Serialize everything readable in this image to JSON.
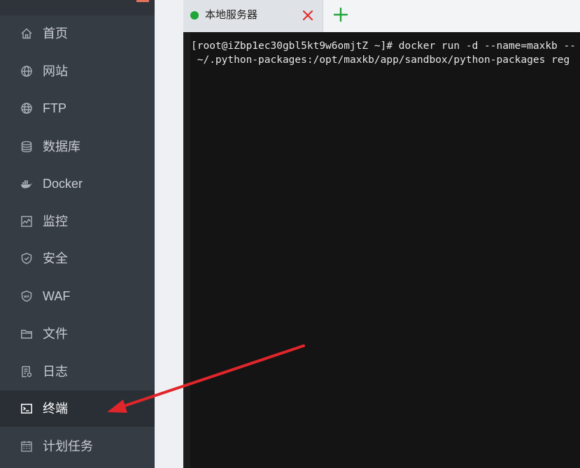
{
  "sidebar": {
    "items": [
      {
        "label": "首页",
        "icon": "home-icon",
        "active": false
      },
      {
        "label": "网站",
        "icon": "globe-icon",
        "active": false
      },
      {
        "label": "FTP",
        "icon": "ftp-globe-icon",
        "active": false
      },
      {
        "label": "数据库",
        "icon": "database-icon",
        "active": false
      },
      {
        "label": "Docker",
        "icon": "docker-whale-icon",
        "active": false
      },
      {
        "label": "监控",
        "icon": "monitor-chart-icon",
        "active": false
      },
      {
        "label": "安全",
        "icon": "shield-icon",
        "active": false
      },
      {
        "label": "WAF",
        "icon": "waf-shield-icon",
        "active": false
      },
      {
        "label": "文件",
        "icon": "folder-icon",
        "active": false
      },
      {
        "label": "日志",
        "icon": "log-document-icon",
        "active": false
      },
      {
        "label": "终端",
        "icon": "terminal-icon",
        "active": true
      },
      {
        "label": "计划任务",
        "icon": "calendar-icon",
        "active": false
      }
    ]
  },
  "terminal": {
    "tab": {
      "label": "本地服务器",
      "status_color": "#20a53a"
    },
    "close_color": "#e03030",
    "add_color": "#20a53a",
    "lines": [
      "[root@iZbp1ec30gbl5kt9w6omjtZ ~]# docker run -d --name=maxkb --",
      " ~/.python-packages:/opt/maxkb/app/sandbox/python-packages reg"
    ]
  },
  "annotation": {
    "arrow_color": "#e0262b"
  }
}
